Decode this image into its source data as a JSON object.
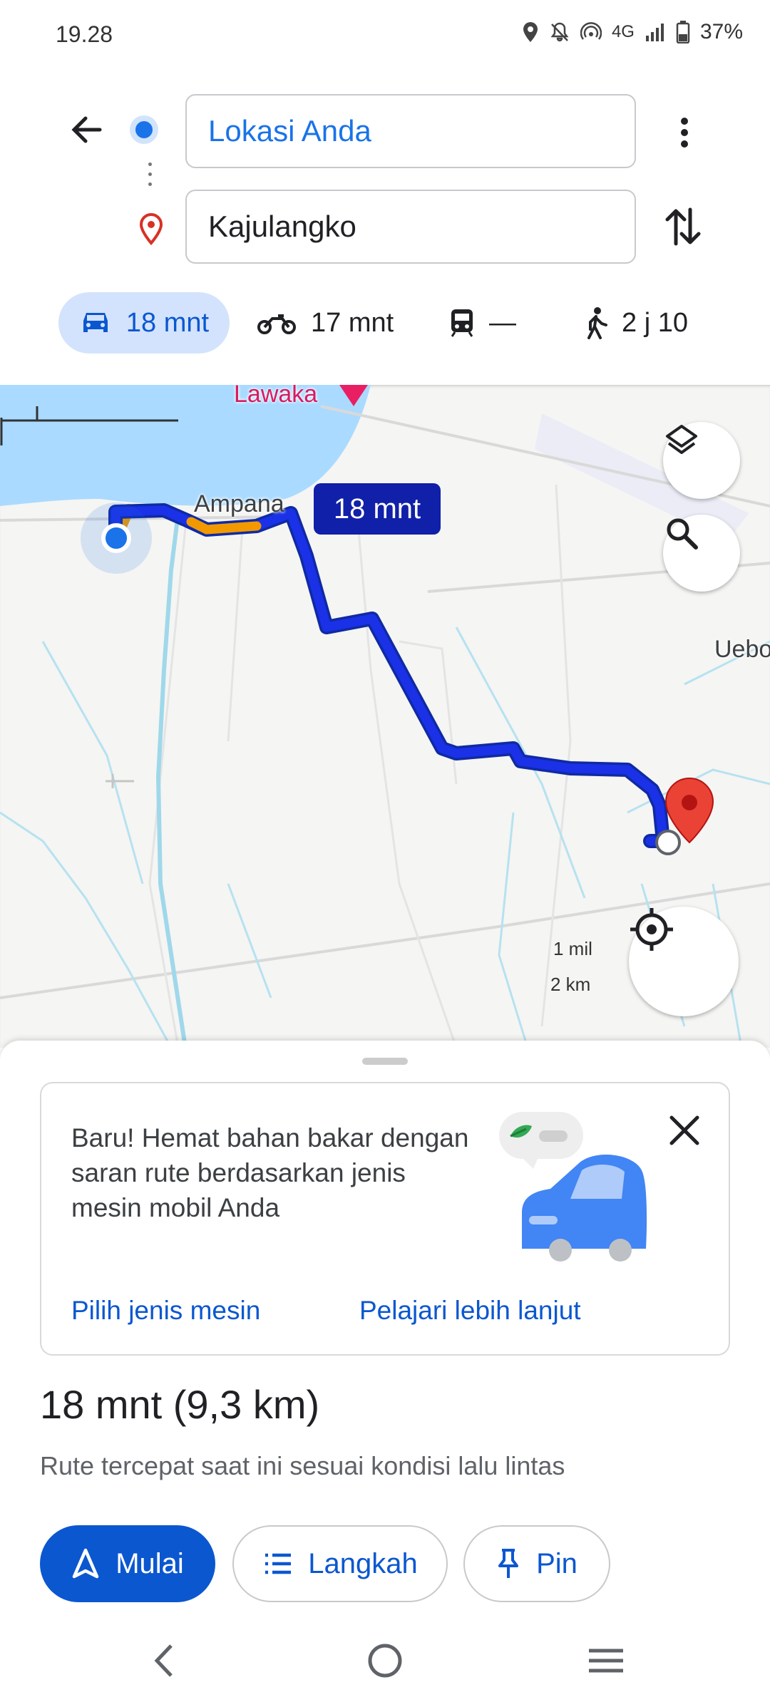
{
  "status_bar": {
    "time": "19.28",
    "network": "4G",
    "battery": "37%",
    "icons": [
      "location-icon",
      "mute-icon",
      "hotspot-icon",
      "signal-icon",
      "battery-icon"
    ]
  },
  "header": {
    "origin": "Lokasi Anda",
    "destination": "Kajulangko"
  },
  "travel_modes": [
    {
      "name": "car",
      "label": "18 mnt",
      "selected": true
    },
    {
      "name": "motorcycle",
      "label": "17 mnt",
      "selected": false
    },
    {
      "name": "transit",
      "label": "—",
      "selected": false
    },
    {
      "name": "walk",
      "label": "2 j 10",
      "selected": false
    }
  ],
  "map": {
    "labels": {
      "lawaka": "Lawaka",
      "ampana": "Ampana",
      "uebo": "Uebo"
    },
    "route_callout": "18 mnt",
    "scale": {
      "miles": "1 mil",
      "km": "2 km"
    },
    "colors": {
      "route": "#1a31e8",
      "traffic": "#f29900",
      "water": "#aadaff",
      "destination_pin": "#ea4335"
    }
  },
  "promo": {
    "text": "Baru! Hemat bahan bakar dengan saran rute berdasarkan jenis mesin mobil Anda",
    "link_engine": "Pilih jenis mesin",
    "link_learn": "Pelajari lebih lanjut"
  },
  "summary": {
    "title": "18 mnt (9,3 km)",
    "description": "Rute tercepat saat ini sesuai kondisi lalu lintas"
  },
  "actions": {
    "start": "Mulai",
    "steps": "Langkah",
    "pin": "Pin"
  },
  "colors": {
    "accent": "#0b57d0",
    "chip_bg": "#d3e3fd"
  }
}
